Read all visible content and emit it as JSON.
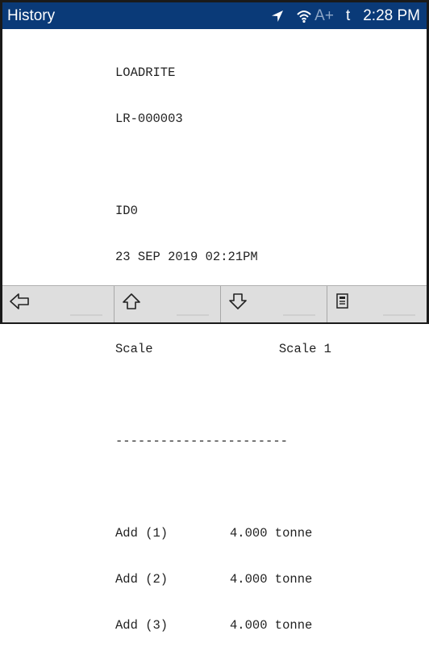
{
  "header": {
    "title": "History",
    "status": {
      "location_icon": "location-arrow-icon",
      "wifi_icon": "wifi-icon",
      "signal_text": "A+",
      "t_text": "t",
      "time": "2:28 PM"
    }
  },
  "receipt": {
    "brand": "LOADRITE",
    "device_id": "LR-000003",
    "record_id": "ID0",
    "datetime": "23 SEP 2019 02:21PM",
    "scale_label": "Scale",
    "scale_value": "Scale 1",
    "separator": "-----------------------",
    "entries": [
      {
        "label": "Add (1)",
        "value": "4.000 tonne"
      },
      {
        "label": "Add (2)",
        "value": "4.000 tonne"
      },
      {
        "label": "Add (3)",
        "value": "4.000 tonne"
      }
    ]
  },
  "bottombar": {
    "buttons": [
      {
        "icon": "arrow-left-icon"
      },
      {
        "icon": "arrow-up-icon"
      },
      {
        "icon": "arrow-down-icon"
      },
      {
        "icon": "document-icon"
      }
    ]
  },
  "colors": {
    "header_bg": "#0a3a78",
    "header_text": "#ffffff",
    "bottombar_bg": "#dedede"
  }
}
